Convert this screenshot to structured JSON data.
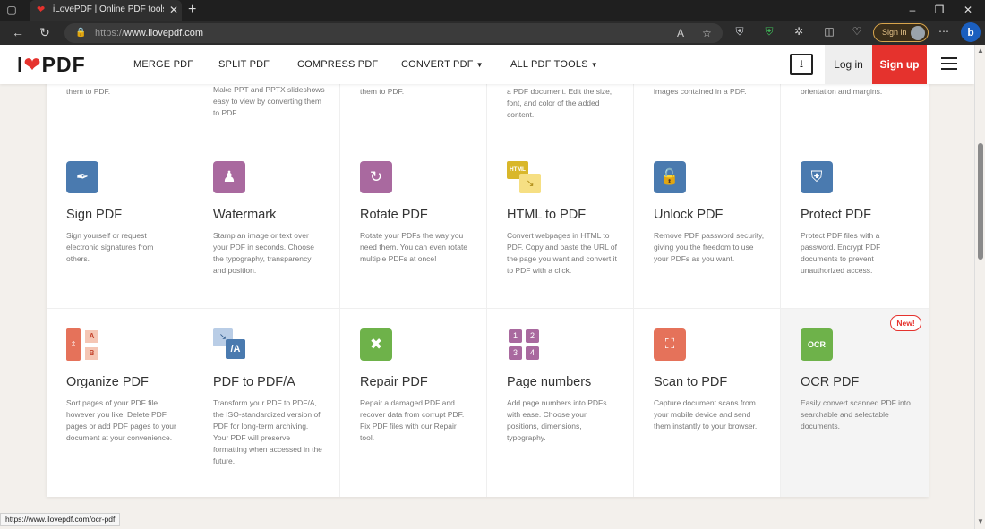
{
  "browser": {
    "tab_title": "iLovePDF | Online PDF tools for PDF Lovers",
    "url_scheme": "https://",
    "url_host": "www.ilovepdf.com",
    "signin_label": "Sign in",
    "status_url": "https://www.ilovepdf.com/ocr-pdf"
  },
  "header": {
    "logo_i": "I",
    "logo_pdf": "PDF",
    "nav": [
      "MERGE PDF",
      "SPLIT PDF",
      "COMPRESS PDF",
      "CONVERT PDF",
      "ALL PDF TOOLS"
    ],
    "login": "Log in",
    "signup": "Sign up"
  },
  "colors": {
    "brand": "#e5322d",
    "sign": "#4a7aaf",
    "watermark": "#a9699f",
    "rotate": "#a9699f",
    "html": "#e3c42f",
    "unlock": "#4a7aaf",
    "protect": "#4a7aaf",
    "organize": "#e5725a",
    "pdfa": "#4a7aaf",
    "repair": "#6eb24a",
    "pagenum": "#a9699f",
    "scan": "#e5725a",
    "ocr": "#6eb24a"
  },
  "row0": [
    {
      "desc": "them to PDF."
    },
    {
      "desc": "Make PPT and PPTX slideshows easy to view by converting them to PDF."
    },
    {
      "desc": "them to PDF."
    },
    {
      "desc": "a PDF document. Edit the size, font, and color of the added content."
    },
    {
      "desc": "images contained in a PDF."
    },
    {
      "desc": "orientation and margins."
    }
  ],
  "row1": [
    {
      "title": "Sign PDF",
      "desc": "Sign yourself or request electronic signatures from others.",
      "icon": "pen-icon"
    },
    {
      "title": "Watermark",
      "desc": "Stamp an image or text over your PDF in seconds. Choose the typography, transparency and position.",
      "icon": "stamp-icon"
    },
    {
      "title": "Rotate PDF",
      "desc": "Rotate your PDFs the way you need them. You can even rotate multiple PDFs at once!",
      "icon": "rotate-icon"
    },
    {
      "title": "HTML to PDF",
      "desc": "Convert webpages in HTML to PDF. Copy and paste the URL of the page you want and convert it to PDF with a click.",
      "icon": "html-icon",
      "icon_text": "HTML"
    },
    {
      "title": "Unlock PDF",
      "desc": "Remove PDF password security, giving you the freedom to use your PDFs as you want.",
      "icon": "unlock-icon"
    },
    {
      "title": "Protect PDF",
      "desc": "Protect PDF files with a password. Encrypt PDF documents to prevent unauthorized access.",
      "icon": "shield-icon"
    }
  ],
  "row2": [
    {
      "title": "Organize PDF",
      "desc": "Sort pages of your PDF file however you like. Delete PDF pages or add PDF pages to your document at your convenience.",
      "icon": "organize-icon",
      "icon_a": "A",
      "icon_b": "B"
    },
    {
      "title": "PDF to PDF/A",
      "desc": "Transform your PDF to PDF/A, the ISO-standardized version of PDF for long-term archiving. Your PDF will preserve formatting when accessed in the future.",
      "icon": "pdfa-icon",
      "icon_text": "/A"
    },
    {
      "title": "Repair PDF",
      "desc": "Repair a damaged PDF and recover data from corrupt PDF. Fix PDF files with our Repair tool.",
      "icon": "wrench-icon"
    },
    {
      "title": "Page numbers",
      "desc": "Add page numbers into PDFs with ease. Choose your positions, dimensions, typography.",
      "icon": "page-numbers-icon",
      "nums": [
        "1",
        "2",
        "3",
        "4"
      ]
    },
    {
      "title": "Scan to PDF",
      "desc": "Capture document scans from your mobile device and send them instantly to your browser.",
      "icon": "scan-icon"
    },
    {
      "title": "OCR PDF",
      "desc": "Easily convert scanned PDF into searchable and selectable documents.",
      "icon": "ocr-icon",
      "icon_text": "OCR",
      "badge": "New!"
    }
  ]
}
